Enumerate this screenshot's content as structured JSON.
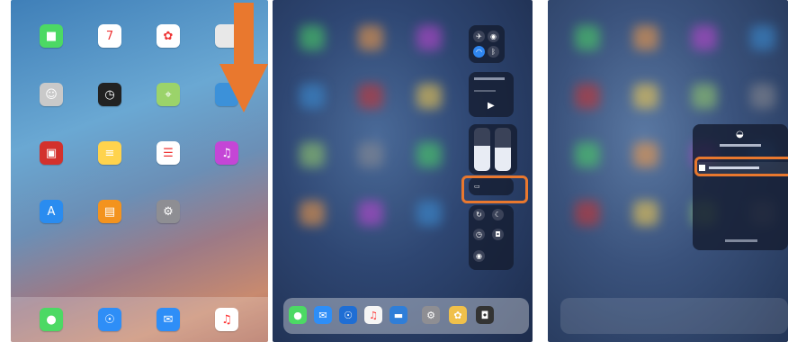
{
  "panel1": {
    "apps": [
      {
        "name": "facetime",
        "icon": "video-camera-icon",
        "color": "#4cd964",
        "glyph": "■",
        "label": "FaceTime"
      },
      {
        "name": "calendar",
        "icon": "calendar-icon",
        "color": "#ffffff",
        "glyph": "7",
        "label": ""
      },
      {
        "name": "photos",
        "icon": "photos-icon",
        "color": "#ffffff",
        "glyph": "✿",
        "label": ""
      },
      {
        "name": "partial",
        "icon": "app-icon",
        "color": "#e8e8e8",
        "glyph": "",
        "label": ""
      },
      {
        "name": "contacts",
        "icon": "contacts-icon",
        "color": "#c9c9c9",
        "glyph": "☺",
        "label": ""
      },
      {
        "name": "clock",
        "icon": "clock-icon",
        "color": "#222222",
        "glyph": "◷",
        "label": ""
      },
      {
        "name": "maps",
        "icon": "maps-icon",
        "color": "#9bd36a",
        "glyph": "⌖",
        "label": ""
      },
      {
        "name": "game-center",
        "icon": "app-icon",
        "color": "#3c91d9",
        "glyph": "",
        "label": ""
      },
      {
        "name": "photo-booth",
        "icon": "photo-booth-icon",
        "color": "#d3312d",
        "glyph": "▣",
        "label": ""
      },
      {
        "name": "notes",
        "icon": "notes-icon",
        "color": "#ffd34d",
        "glyph": "≡",
        "label": ""
      },
      {
        "name": "reminders",
        "icon": "reminders-icon",
        "color": "#ffffff",
        "glyph": "☰",
        "label": ""
      },
      {
        "name": "itunes-store",
        "icon": "music-note-icon",
        "color": "#c446d6",
        "glyph": "♫",
        "label": ""
      },
      {
        "name": "app-store",
        "icon": "app-store-icon",
        "color": "#2a8cf0",
        "glyph": "A",
        "label": ""
      },
      {
        "name": "ibooks",
        "icon": "book-icon",
        "color": "#f3931e",
        "glyph": "▤",
        "label": ""
      },
      {
        "name": "settings",
        "icon": "gear-icon",
        "color": "#8e8e93",
        "glyph": "⚙",
        "label": ""
      }
    ],
    "dock": [
      {
        "name": "messages",
        "icon": "chat-bubble-icon",
        "color": "#4cd964",
        "glyph": "●"
      },
      {
        "name": "safari",
        "icon": "compass-icon",
        "color": "#2e8ef7",
        "glyph": "☉"
      },
      {
        "name": "mail",
        "icon": "envelope-icon",
        "color": "#2e8ef7",
        "glyph": "✉"
      },
      {
        "name": "music",
        "icon": "music-note-icon",
        "color": "#ffffff",
        "glyph": "♫"
      }
    ]
  },
  "panel2": {
    "dock": [
      {
        "icon": "chat-bubble-icon",
        "color": "#4cd964",
        "glyph": "●"
      },
      {
        "icon": "envelope-icon",
        "color": "#2e8ef7",
        "glyph": "✉"
      },
      {
        "icon": "compass-icon",
        "color": "#1f6ed4",
        "glyph": "☉"
      },
      {
        "icon": "music-note-icon",
        "color": "#f5f5f5",
        "glyph": "♫"
      },
      {
        "icon": "folder-icon",
        "color": "#2f7ed8",
        "glyph": "▬"
      },
      {
        "icon": "gear-icon",
        "color": "#8e8e93",
        "glyph": "⚙"
      },
      {
        "icon": "photos-icon",
        "color": "#f0c04a",
        "glyph": "✿"
      },
      {
        "icon": "camera-icon",
        "color": "#333333",
        "glyph": "◘"
      }
    ]
  },
  "colors": {
    "accent": "#e9782e"
  }
}
